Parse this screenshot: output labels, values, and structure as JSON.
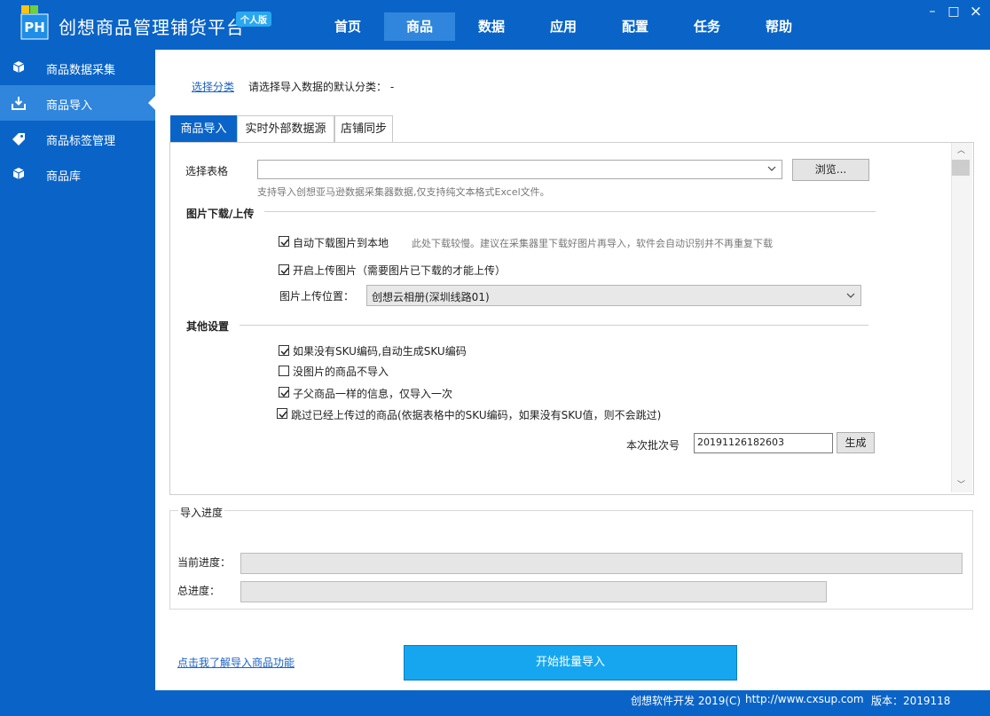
{
  "app": {
    "title": "创想商品管理铺货平台",
    "edition": "个人版",
    "logo_text": "PH"
  },
  "nav": [
    "首页",
    "商品",
    "数据",
    "应用",
    "配置",
    "任务",
    "帮助"
  ],
  "window": {
    "minimize": "–",
    "maximize": "□",
    "close": "×"
  },
  "sidebar": {
    "items": [
      {
        "label": "商品数据采集",
        "icon": "cube-icon"
      },
      {
        "label": "商品导入",
        "icon": "download-tray-icon"
      },
      {
        "label": "商品标签管理",
        "icon": "tag-icon"
      },
      {
        "label": "商品库",
        "icon": "box-icon"
      }
    ]
  },
  "category": {
    "link": "选择分类",
    "text": "请选择导入数据的默认分类：  -"
  },
  "tabs": [
    "商品导入",
    "实时外部数据源",
    "店铺同步"
  ],
  "import_form": {
    "select_table_label": "选择表格",
    "select_table_value": "",
    "browse_button": "浏览...",
    "table_hint": "支持导入创想亚马逊数据采集器数据,仅支持纯文本格式Excel文件。",
    "image_section": "图片下载/上传",
    "auto_download_label": "自动下载图片到本地",
    "auto_download_checked": true,
    "auto_download_hint": "此处下载较慢。建议在采集器里下载好图片再导入，软件会自动识别并不再重复下载",
    "enable_upload_label": "开启上传图片（需要图片已下载的才能上传）",
    "enable_upload_checked": true,
    "upload_location_label": "图片上传位置：",
    "upload_location_value": "创想云相册(深圳线路01)",
    "other_section": "其他设置",
    "options": [
      {
        "label": "如果没有SKU编码,自动生成SKU编码",
        "checked": true
      },
      {
        "label": "没图片的商品不导入",
        "checked": false
      },
      {
        "label": "子父商品一样的信息，仅导入一次",
        "checked": true
      },
      {
        "label": "跳过已经上传过的商品(依据表格中的SKU编码，如果没有SKU值，则不会跳过)",
        "checked": true
      }
    ],
    "batch_label": "本次批次号",
    "batch_value": "20191126182603",
    "generate_button": "生成"
  },
  "progress": {
    "title": "导入进度",
    "current_label": "当前进度：",
    "current_value": 0,
    "total_label": "总进度：",
    "total_value": 0
  },
  "help_link": "点击我了解导入商品功能",
  "start_button": "开始批量导入",
  "footer": {
    "copyright": "创想软件开发 2019(C)",
    "url": "http://www.cxsup.com",
    "version": "版本：2019118"
  },
  "colors": {
    "brand_blue": "#0a64c8",
    "active_blue": "#2f86dc",
    "start_button": "#16a6f0"
  }
}
